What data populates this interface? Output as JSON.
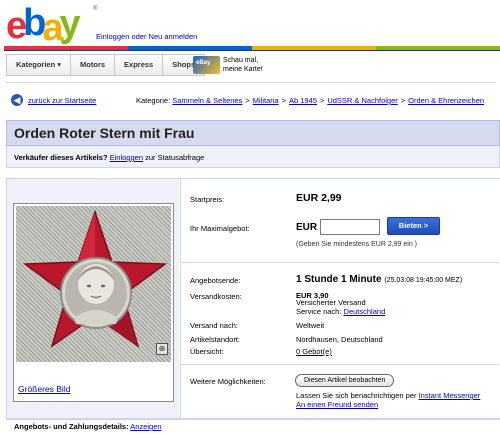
{
  "header": {
    "logo_letters": [
      "e",
      "b",
      "a",
      "y"
    ],
    "signin_text": "Einloggen oder Neu anmelden",
    "trademark": "®"
  },
  "nav": {
    "items": [
      {
        "label": "Kategorien ▾"
      },
      {
        "label": "Motors"
      },
      {
        "label": "Express"
      },
      {
        "label": "Shops"
      }
    ],
    "promo_line1": "Schau mal,",
    "promo_line2": "meine Karte!"
  },
  "breadcrumb": {
    "back_label": "zurück zur Startseite",
    "prefix": "Kategorie:",
    "items": [
      "Sammeln & Seltenes",
      "Militaria",
      "Ab 1945",
      "UdSSR & Nachfolger",
      "Orden & Ehrenzeichen"
    ],
    "separator": ">"
  },
  "listing": {
    "title": "Orden Roter Stern mit Frau",
    "seller_label": "Verkäufer dieses Artikels?",
    "seller_link": "Einloggen",
    "seller_suffix": "zur Statusabfrage",
    "image_link": "Größeres Bild",
    "start_price_label": "Startpreis:",
    "start_price": "EUR 2,99",
    "max_bid_label": "Ihr Maximalgebot:",
    "bid_currency": "EUR",
    "bid_value": "",
    "bid_button": "Bieten >",
    "bid_hint": "(Geben Sie mindestens EUR 2,99 ein )",
    "end_label": "Angebotsende:",
    "end_time_big": "1 Stunde 1 Minute",
    "end_time_small": "(25.03.08 19:45:00 MEZ)",
    "shipping_label": "Versandkosten:",
    "shipping_price": "EUR 3,90",
    "shipping_type": "Versicherter Versand",
    "service_prefix": "Service nach:",
    "service_link": "Deutschland",
    "ship_to_label": "Versand nach:",
    "ship_to": "Weltweit",
    "location_label": "Artikelstandort:",
    "location": "Nordhausen, Deutschland",
    "overview_label": "Übersicht:",
    "overview_link": "0 Gebot(e)",
    "more_label": "Weitere Möglichkeiten:",
    "watch_button": "Diesen Artikel beobachten",
    "notify_text": "Lassen Sie sich benachrichtigen per",
    "notify_link": "Instant Messenger",
    "friend_link": "An einen Freund senden"
  },
  "footer": {
    "label": "Angebots- und Zahlungsdetails:",
    "link": "Anzeigen"
  },
  "colors": {
    "ebay_red": "#e53238",
    "ebay_blue": "#0064d2",
    "ebay_yellow": "#f5af02",
    "ebay_green": "#86b817",
    "title_bar": "#d6daef",
    "link": "#0000cc",
    "bid_button": "#2a5bc6"
  }
}
